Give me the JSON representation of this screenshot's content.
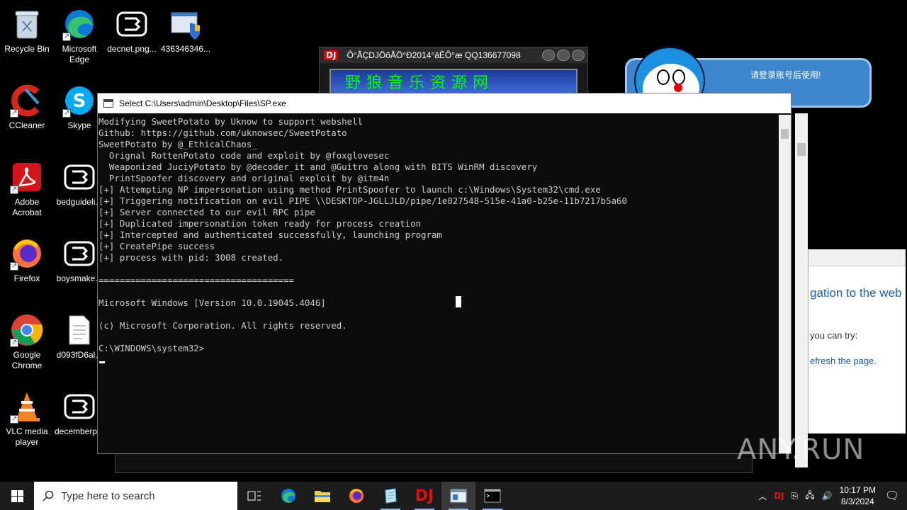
{
  "desktop": {
    "icons": [
      {
        "label": "Recycle Bin"
      },
      {
        "label": "Microsoft Edge"
      },
      {
        "label": "decnet.png..."
      },
      {
        "label": "436346346..."
      },
      {
        "label": "CCleaner"
      },
      {
        "label": "Skype"
      },
      {
        "label": "Adobe Acrobat"
      },
      {
        "label": "bedguideli..."
      },
      {
        "label": "Firefox"
      },
      {
        "label": "boysmake..."
      },
      {
        "label": "Google Chrome"
      },
      {
        "label": "d093fD6al..."
      },
      {
        "label": "VLC media player"
      },
      {
        "label": "decemberp..."
      }
    ]
  },
  "dj_window": {
    "badge": "DJ",
    "title": "Ô°ÃÇDJÖõÅÖ°Ð2014°âÊÔ°æ QQ136677098",
    "banner": "野狼音乐资源网"
  },
  "popup": {
    "message": "请登录账号后使用!"
  },
  "browser": {
    "line1": "gation to the web",
    "line2": "you can try:",
    "line3": "efresh the page."
  },
  "console": {
    "title": "Select C:\\Users\\admin\\Desktop\\Files\\SP.exe",
    "output": "Modifying SweetPotato by Uknow to support webshell\nGithub: https://github.com/uknowsec/SweetPotato\nSweetPotato by @_EthicalChaos_\n  Orignal RottenPotato code and exploit by @foxglovesec\n  Weaponized JuciyPotato by @decoder_it and @Guitro along with BITS WinRM discovery\n  PrintSpoofer discovery and original exploit by @itm4n\n[+] Attempting NP impersonation using method PrintSpoofer to launch c:\\Windows\\System32\\cmd.exe\n[+] Triggering notification on evil PIPE \\\\DESKTOP-JGLLJLD/pipe/1e027548-515e-41a0-b25e-11b7217b5a60\n[+] Server connected to our evil RPC pipe\n[+] Duplicated impersonation token ready for process creation\n[+] Intercepted and authenticated successfully, launching program\n[+] CreatePipe success\n[+] process with pid: 3008 created.\n\n=====================================\n\nMicrosoft Windows [Version 10.0.19045.4046]\n\n(c) Microsoft Corporation. All rights reserved.\n\nC:\\WINDOWS\\system32>"
  },
  "watermark": "ANY.RUN",
  "taskbar": {
    "search_placeholder": "Type here to search",
    "time": "10:17 PM",
    "date": "8/3/2024",
    "dj_label": "DJ"
  },
  "colors": {
    "console_bg": "#0c0c0c",
    "console_text": "#cccccc",
    "taskbar_bg": "#1c1c1c",
    "popup_bg": "#3b86cc"
  }
}
